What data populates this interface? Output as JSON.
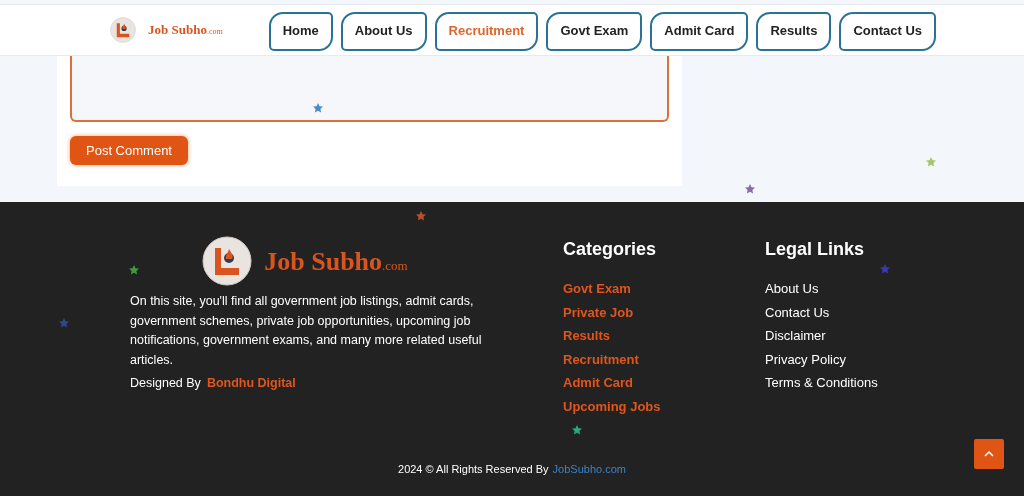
{
  "header": {
    "logo": {
      "name": "Job Subho",
      "suffix": ".com"
    },
    "nav": [
      {
        "label": "Home",
        "selected": false
      },
      {
        "label": "About Us",
        "selected": false
      },
      {
        "label": "Recruitment",
        "selected": true
      },
      {
        "label": "Govt Exam",
        "selected": false
      },
      {
        "label": "Admit Card",
        "selected": false
      },
      {
        "label": "Results",
        "selected": false
      },
      {
        "label": "Contact Us",
        "selected": false
      }
    ]
  },
  "comment_form": {
    "button": "Post Comment"
  },
  "footer": {
    "logo": {
      "name": "Job Subho",
      "suffix": ".com"
    },
    "description": "On this site, you'll find all government job listings, admit cards, government schemes, private job opportunities, upcoming job notifications, government exams, and many more related useful articles.",
    "designed_by": "Designed By",
    "designer": "Bondhu Digital",
    "categories": {
      "title": "Categories",
      "links": [
        "Govt Exam",
        "Private Job",
        "Results",
        "Recruitment",
        "Admit Card",
        "Upcoming Jobs"
      ]
    },
    "legal": {
      "title": "Legal Links",
      "links": [
        "About Us",
        "Contact Us",
        "Disclaimer",
        "Privacy Policy",
        "Terms & Conditions"
      ]
    },
    "copyright": "2024 © All Rights Reserved By",
    "copyright_link": "JobSubho.com"
  },
  "stars": [
    {
      "color": "#4a8cc4"
    },
    {
      "color": "#a8c46a"
    },
    {
      "color": "#8a6aa8"
    },
    {
      "color": "#b8502a"
    },
    {
      "color": "#3e9a3e"
    },
    {
      "color": "#2a4a8a"
    },
    {
      "color": "#3a3ab0"
    },
    {
      "color": "#2aa87a"
    }
  ]
}
